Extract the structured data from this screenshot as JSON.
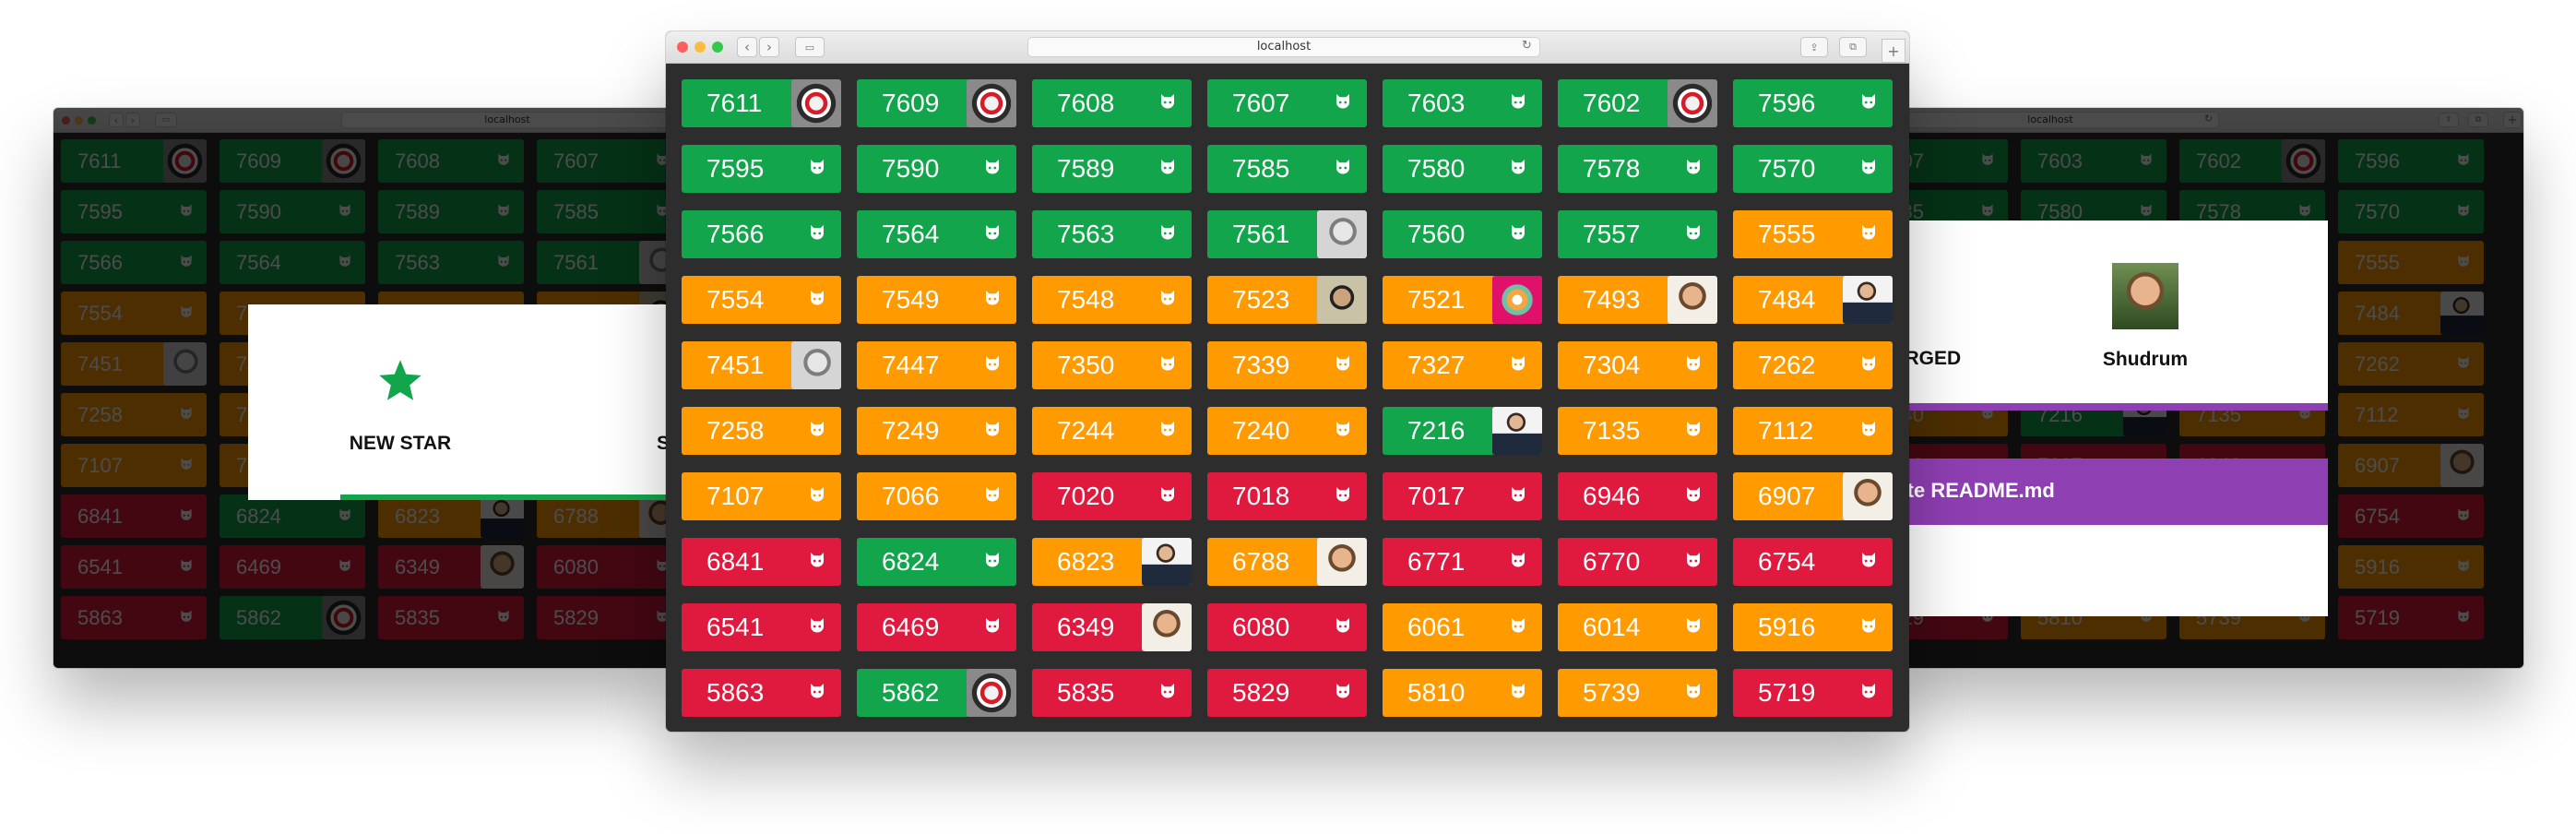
{
  "browser": {
    "address": "localhost"
  },
  "tiles": [
    {
      "n": "7611",
      "c": "g",
      "a": "helmet"
    },
    {
      "n": "7609",
      "c": "g",
      "a": "helmet"
    },
    {
      "n": "7608",
      "c": "g"
    },
    {
      "n": "7607",
      "c": "g"
    },
    {
      "n": "7603",
      "c": "g"
    },
    {
      "n": "7602",
      "c": "g",
      "a": "helmet"
    },
    {
      "n": "7596",
      "c": "g"
    },
    {
      "n": "7595",
      "c": "g"
    },
    {
      "n": "7590",
      "c": "g"
    },
    {
      "n": "7589",
      "c": "g"
    },
    {
      "n": "7585",
      "c": "g"
    },
    {
      "n": "7580",
      "c": "g"
    },
    {
      "n": "7578",
      "c": "g"
    },
    {
      "n": "7570",
      "c": "g"
    },
    {
      "n": "7566",
      "c": "g"
    },
    {
      "n": "7564",
      "c": "g"
    },
    {
      "n": "7563",
      "c": "g"
    },
    {
      "n": "7561",
      "c": "g",
      "a": "face-gray"
    },
    {
      "n": "7560",
      "c": "g"
    },
    {
      "n": "7557",
      "c": "g"
    },
    {
      "n": "7555",
      "c": "o"
    },
    {
      "n": "7554",
      "c": "o"
    },
    {
      "n": "7549",
      "c": "o"
    },
    {
      "n": "7548",
      "c": "o"
    },
    {
      "n": "7523",
      "c": "o",
      "a": "face-dark"
    },
    {
      "n": "7521",
      "c": "o",
      "a": "logo-g"
    },
    {
      "n": "7493",
      "c": "o",
      "a": "face-warm"
    },
    {
      "n": "7484",
      "c": "o",
      "a": "face-suit"
    },
    {
      "n": "7451",
      "c": "o",
      "a": "face-gray"
    },
    {
      "n": "7447",
      "c": "o"
    },
    {
      "n": "7350",
      "c": "o"
    },
    {
      "n": "7339",
      "c": "o"
    },
    {
      "n": "7327",
      "c": "o"
    },
    {
      "n": "7304",
      "c": "o"
    },
    {
      "n": "7262",
      "c": "o"
    },
    {
      "n": "7258",
      "c": "o"
    },
    {
      "n": "7249",
      "c": "o"
    },
    {
      "n": "7244",
      "c": "o"
    },
    {
      "n": "7240",
      "c": "o"
    },
    {
      "n": "7216",
      "c": "g",
      "a": "face-suit"
    },
    {
      "n": "7135",
      "c": "o"
    },
    {
      "n": "7112",
      "c": "o"
    },
    {
      "n": "7107",
      "c": "o"
    },
    {
      "n": "7066",
      "c": "o"
    },
    {
      "n": "7020",
      "c": "r"
    },
    {
      "n": "7018",
      "c": "r"
    },
    {
      "n": "7017",
      "c": "r"
    },
    {
      "n": "6946",
      "c": "r"
    },
    {
      "n": "6907",
      "c": "o",
      "a": "face-warm"
    },
    {
      "n": "6841",
      "c": "r"
    },
    {
      "n": "6824",
      "c": "g"
    },
    {
      "n": "6823",
      "c": "o",
      "a": "face-suit"
    },
    {
      "n": "6788",
      "c": "o",
      "a": "face-warm"
    },
    {
      "n": "6771",
      "c": "r"
    },
    {
      "n": "6770",
      "c": "r"
    },
    {
      "n": "6754",
      "c": "r"
    },
    {
      "n": "6541",
      "c": "r"
    },
    {
      "n": "6469",
      "c": "r"
    },
    {
      "n": "6349",
      "c": "r",
      "a": "face-warm"
    },
    {
      "n": "6080",
      "c": "r"
    },
    {
      "n": "6061",
      "c": "o"
    },
    {
      "n": "6014",
      "c": "o"
    },
    {
      "n": "5916",
      "c": "o"
    },
    {
      "n": "5863",
      "c": "r"
    },
    {
      "n": "5862",
      "c": "g",
      "a": "helmet"
    },
    {
      "n": "5835",
      "c": "r"
    },
    {
      "n": "5829",
      "c": "r"
    },
    {
      "n": "5810",
      "c": "o"
    },
    {
      "n": "5739",
      "c": "o"
    },
    {
      "n": "5719",
      "c": "r"
    }
  ],
  "colors": {
    "green": "#13a54b",
    "orange": "#ff9a00",
    "red": "#e0193e",
    "purple": "#8e3fb2"
  },
  "left_overlay": {
    "event_label": "NEW STAR",
    "event_icon": "star-icon",
    "cut_text": "S"
  },
  "right_overlay": {
    "status_label": "MERGED",
    "user_name": "Shudrum",
    "commit_message": "date README.md"
  }
}
